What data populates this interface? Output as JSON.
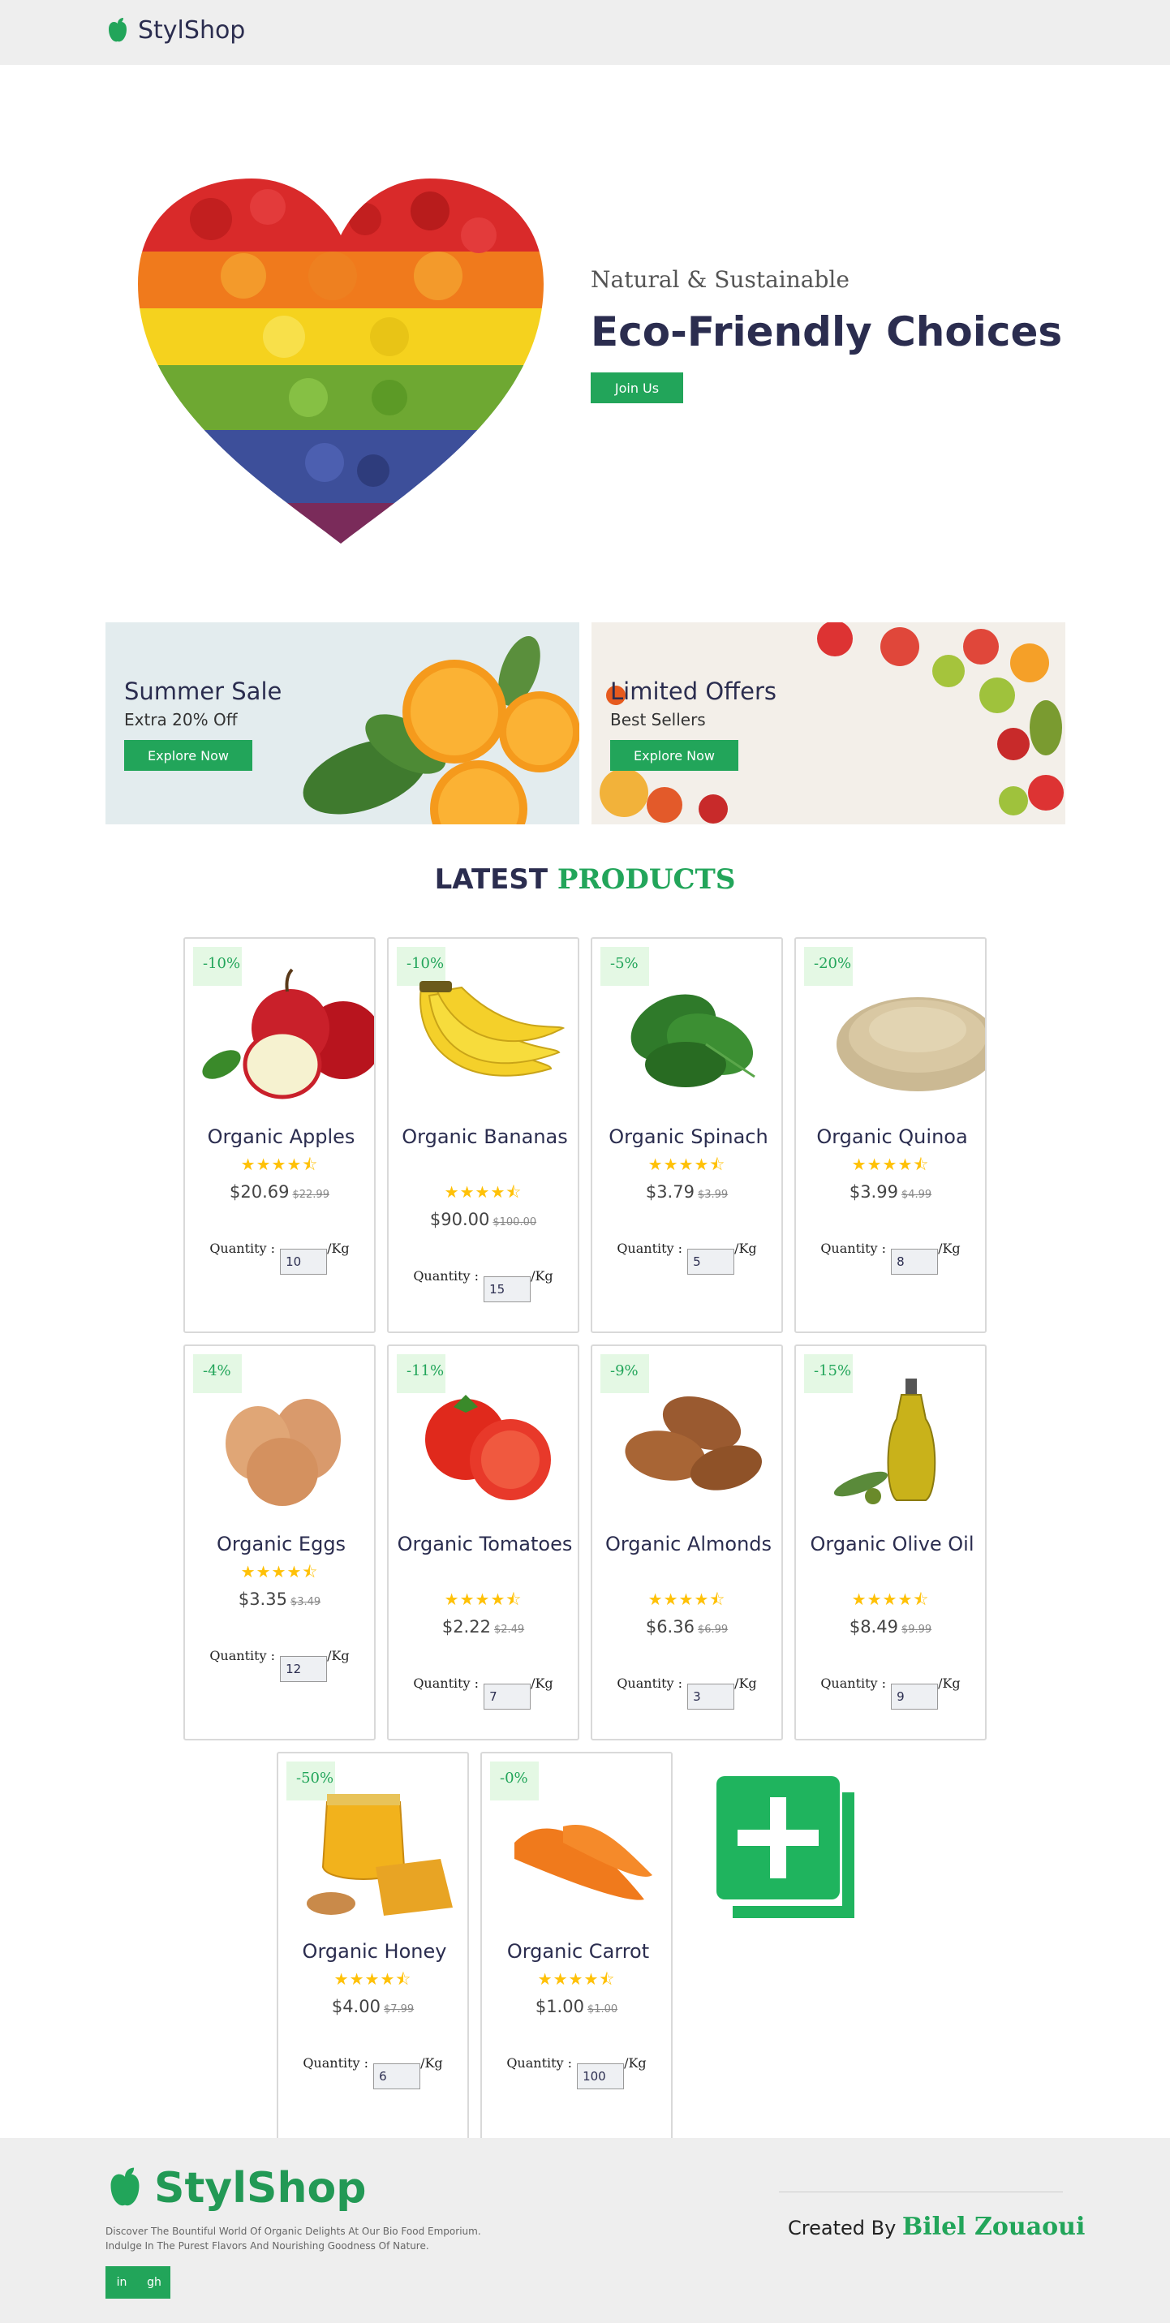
{
  "header": {
    "brand": "StylShop",
    "logo_icon": "apple-icon"
  },
  "hero": {
    "subtitle": "Natural & Sustainable",
    "title": "Eco-Friendly Choices",
    "button": "Join Us"
  },
  "banners": [
    {
      "title": "Summer Sale",
      "subtitle": "Extra 20% Off",
      "button": "Explore Now"
    },
    {
      "title": "Limited Offers",
      "subtitle": "Best Sellers",
      "button": "Explore Now"
    }
  ],
  "section": {
    "title_part1": "LATEST",
    "title_part2": "PRODUCTS"
  },
  "products": [
    {
      "discount": "-10%",
      "name": "Organic Apples",
      "stars": "★★★★⯪",
      "price": "$20.69",
      "old_price": "$22.99",
      "qty_label": "Quantity :",
      "qty": "10",
      "unit": "/Kg"
    },
    {
      "discount": "-10%",
      "name": "Organic Bananas",
      "stars": "★★★★⯪",
      "price": "$90.00",
      "old_price": "$100.00",
      "qty_label": "Quantity :",
      "qty": "15",
      "unit": "/Kg"
    },
    {
      "discount": "-5%",
      "name": "Organic Spinach",
      "stars": "★★★★⯪",
      "price": "$3.79",
      "old_price": "$3.99",
      "qty_label": "Quantity :",
      "qty": "5",
      "unit": "/Kg"
    },
    {
      "discount": "-20%",
      "name": "Organic Quinoa",
      "stars": "★★★★⯪",
      "price": "$3.99",
      "old_price": "$4.99",
      "qty_label": "Quantity :",
      "qty": "8",
      "unit": "/Kg"
    },
    {
      "discount": "-4%",
      "name": "Organic Eggs",
      "stars": "★★★★⯪",
      "price": "$3.35",
      "old_price": "$3.49",
      "qty_label": "Quantity :",
      "qty": "12",
      "unit": "/Kg"
    },
    {
      "discount": "-11%",
      "name": "Organic Tomatoes",
      "stars": "★★★★⯪",
      "price": "$2.22",
      "old_price": "$2.49",
      "qty_label": "Quantity :",
      "qty": "7",
      "unit": "/Kg"
    },
    {
      "discount": "-9%",
      "name": "Organic Almonds",
      "stars": "★★★★⯪",
      "price": "$6.36",
      "old_price": "$6.99",
      "qty_label": "Quantity :",
      "qty": "3",
      "unit": "/Kg"
    },
    {
      "discount": "-15%",
      "name": "Organic Olive Oil",
      "stars": "★★★★⯪",
      "price": "$8.49",
      "old_price": "$9.99",
      "qty_label": "Quantity :",
      "qty": "9",
      "unit": "/Kg"
    },
    {
      "discount": "-50%",
      "name": "Organic Honey",
      "stars": "★★★★⯪",
      "price": "$4.00",
      "old_price": "$7.99",
      "qty_label": "Quantity :",
      "qty": "6",
      "unit": "/Kg"
    },
    {
      "discount": "-0%",
      "name": "Organic Carrot",
      "stars": "★★★★⯪",
      "price": "$1.00",
      "old_price": "$1.00",
      "qty_label": "Quantity :",
      "qty": "100",
      "unit": "/Kg"
    }
  ],
  "add_product_icon": "add-product-icon",
  "footer": {
    "brand": "StylShop",
    "desc_line1": "Discover The Bountiful World Of Organic Delights At Our Bio Food Emporium.",
    "desc_line2": "Indulge In The Purest Flavors And Nourishing Goodness Of Nature.",
    "social": [
      "linkedin-icon",
      "github-icon"
    ],
    "social_labels": [
      "in",
      "gh"
    ],
    "credit_prefix": "Created By",
    "credit_author": "Bilel Zouaoui"
  },
  "colors": {
    "accent": "#22a55a",
    "dark": "#2b2d4f",
    "star": "#ffc107",
    "discount_bg": "#e4f8e4"
  }
}
